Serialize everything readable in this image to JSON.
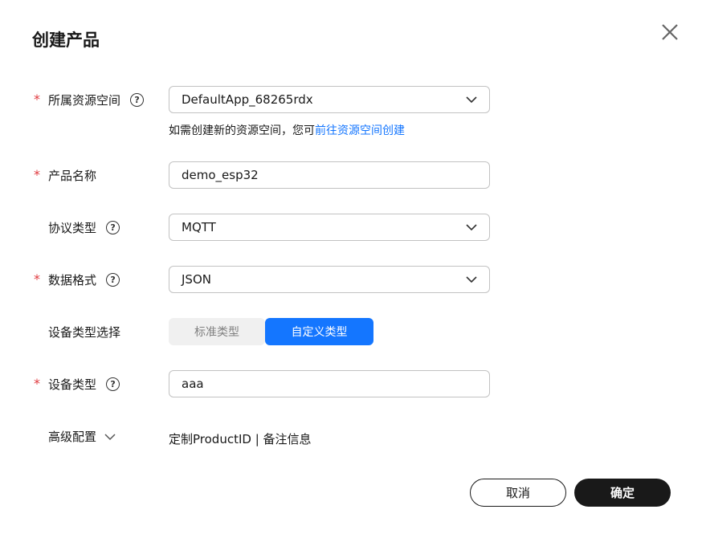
{
  "dialog": {
    "title": "创建产品"
  },
  "form": {
    "resource_space": {
      "required": "*",
      "label": "所属资源空间",
      "value": "DefaultApp_68265rdx",
      "hint_text": "如需创建新的资源空间，您可",
      "hint_link": "前往资源空间创建"
    },
    "product_name": {
      "required": "*",
      "label": "产品名称",
      "value": "demo_esp32"
    },
    "protocol": {
      "label": "协议类型",
      "value": "MQTT"
    },
    "data_format": {
      "required": "*",
      "label": "数据格式",
      "value": "JSON"
    },
    "device_type_select": {
      "label": "设备类型选择",
      "options": [
        "标准类型",
        "自定义类型"
      ],
      "selected": "自定义类型"
    },
    "device_type": {
      "required": "*",
      "label": "设备类型",
      "value": "aaa"
    },
    "advanced": {
      "label": "高级配置",
      "summary": "定制ProductID | 备注信息"
    }
  },
  "footer": {
    "cancel_label": "取消",
    "confirm_label": "确定"
  },
  "colors": {
    "accent": "#1476ff",
    "required": "#e0393e",
    "primary_button": "#191919"
  }
}
